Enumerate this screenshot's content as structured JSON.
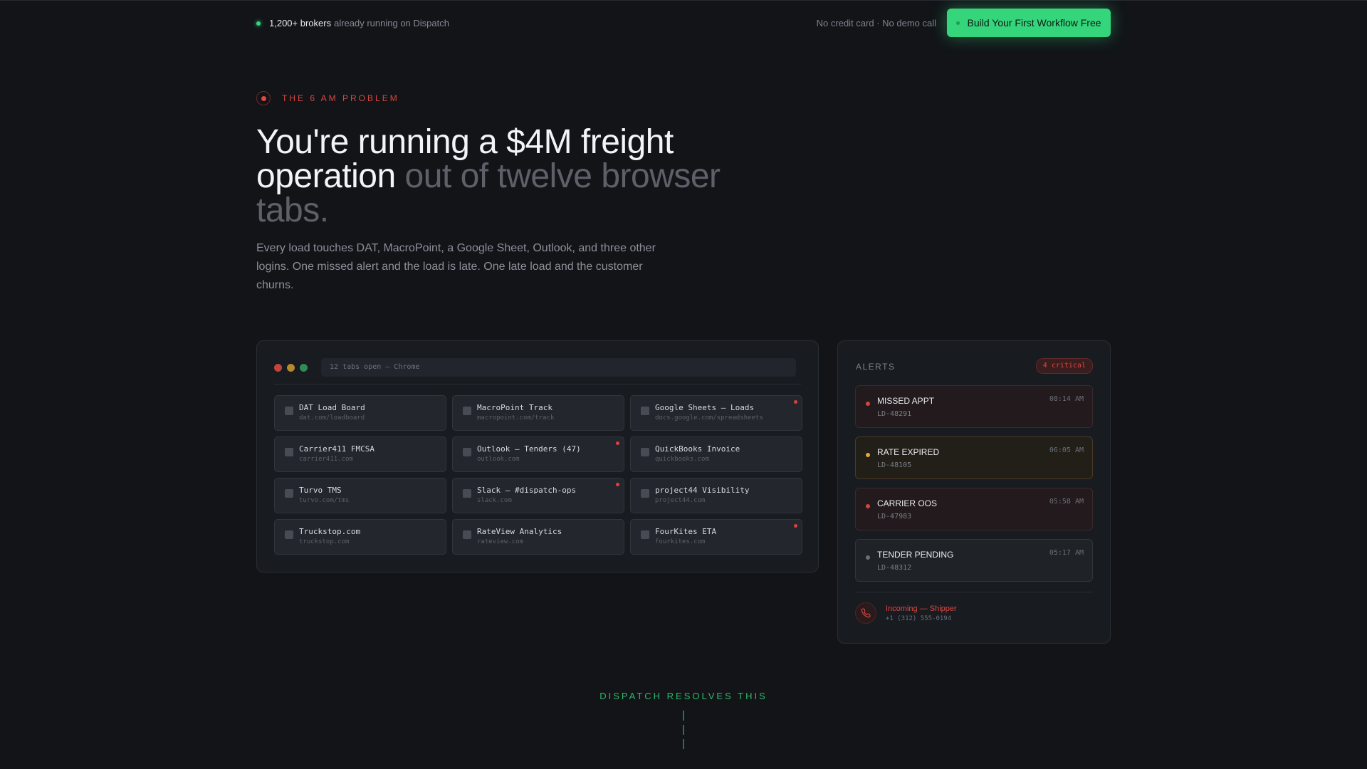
{
  "topbar": {
    "social_count": "1,200+ brokers",
    "social_text": "already running on Dispatch",
    "no_card": "No credit card · No demo call",
    "cta_label": "Build Your First Workflow Free"
  },
  "hero": {
    "eyebrow": "THE 6 AM PROBLEM",
    "headline_bright": "You're running a $4M freight operation",
    "headline_dim": "out of twelve browser tabs.",
    "subcopy": "Every load touches DAT, MacroPoint, a Google Sheet, Outlook, and three other logins. One missed alert and the load is late. One late load and the customer churns."
  },
  "browser": {
    "address": "12 tabs open — Chrome",
    "tabs": [
      {
        "name": "DAT Load Board",
        "url": "dat.com/loadboard",
        "alert": false
      },
      {
        "name": "MacroPoint Track",
        "url": "macropoint.com/track",
        "alert": false
      },
      {
        "name": "Google Sheets — Loads",
        "url": "docs.google.com/spreadsheets",
        "alert": true
      },
      {
        "name": "Carrier411 FMCSA",
        "url": "carrier411.com",
        "alert": false
      },
      {
        "name": "Outlook — Tenders (47)",
        "url": "outlook.com",
        "alert": true
      },
      {
        "name": "QuickBooks Invoice",
        "url": "quickbooks.com",
        "alert": false
      },
      {
        "name": "Turvo TMS",
        "url": "turvo.com/tms",
        "alert": false
      },
      {
        "name": "Slack — #dispatch-ops",
        "url": "slack.com",
        "alert": true
      },
      {
        "name": "project44 Visibility",
        "url": "project44.com",
        "alert": false
      },
      {
        "name": "Truckstop.com",
        "url": "truckstop.com",
        "alert": false
      },
      {
        "name": "RateView Analytics",
        "url": "rateview.com",
        "alert": false
      },
      {
        "name": "FourKites ETA",
        "url": "fourkites.com",
        "alert": true
      }
    ]
  },
  "alerts": {
    "heading": "ALERTS",
    "badge": "4 critical",
    "items": [
      {
        "title": "MISSED APPT",
        "id": "LD-48291",
        "time": "08:14 AM",
        "tone": "red",
        "dot_color": "#d8443b"
      },
      {
        "title": "RATE EXPIRED",
        "id": "LD-48105",
        "time": "06:05 AM",
        "tone": "amber",
        "dot_color": "#e0a83a"
      },
      {
        "title": "CARRIER OOS",
        "id": "LD-47983",
        "time": "05:58 AM",
        "tone": "red",
        "dot_color": "#d8443b"
      },
      {
        "title": "TENDER PENDING",
        "id": "LD-48312",
        "time": "05:17 AM",
        "tone": "neutral",
        "dot_color": "#6b7078"
      }
    ],
    "call": {
      "title": "Incoming — Shipper",
      "number": "+1 (312) 555-0194",
      "icon": "phone-icon"
    }
  },
  "footer": {
    "resolves": "DISPATCH RESOLVES THIS"
  },
  "colors": {
    "accent": "#34d57b",
    "danger": "#d8443b",
    "background": "#121418"
  }
}
